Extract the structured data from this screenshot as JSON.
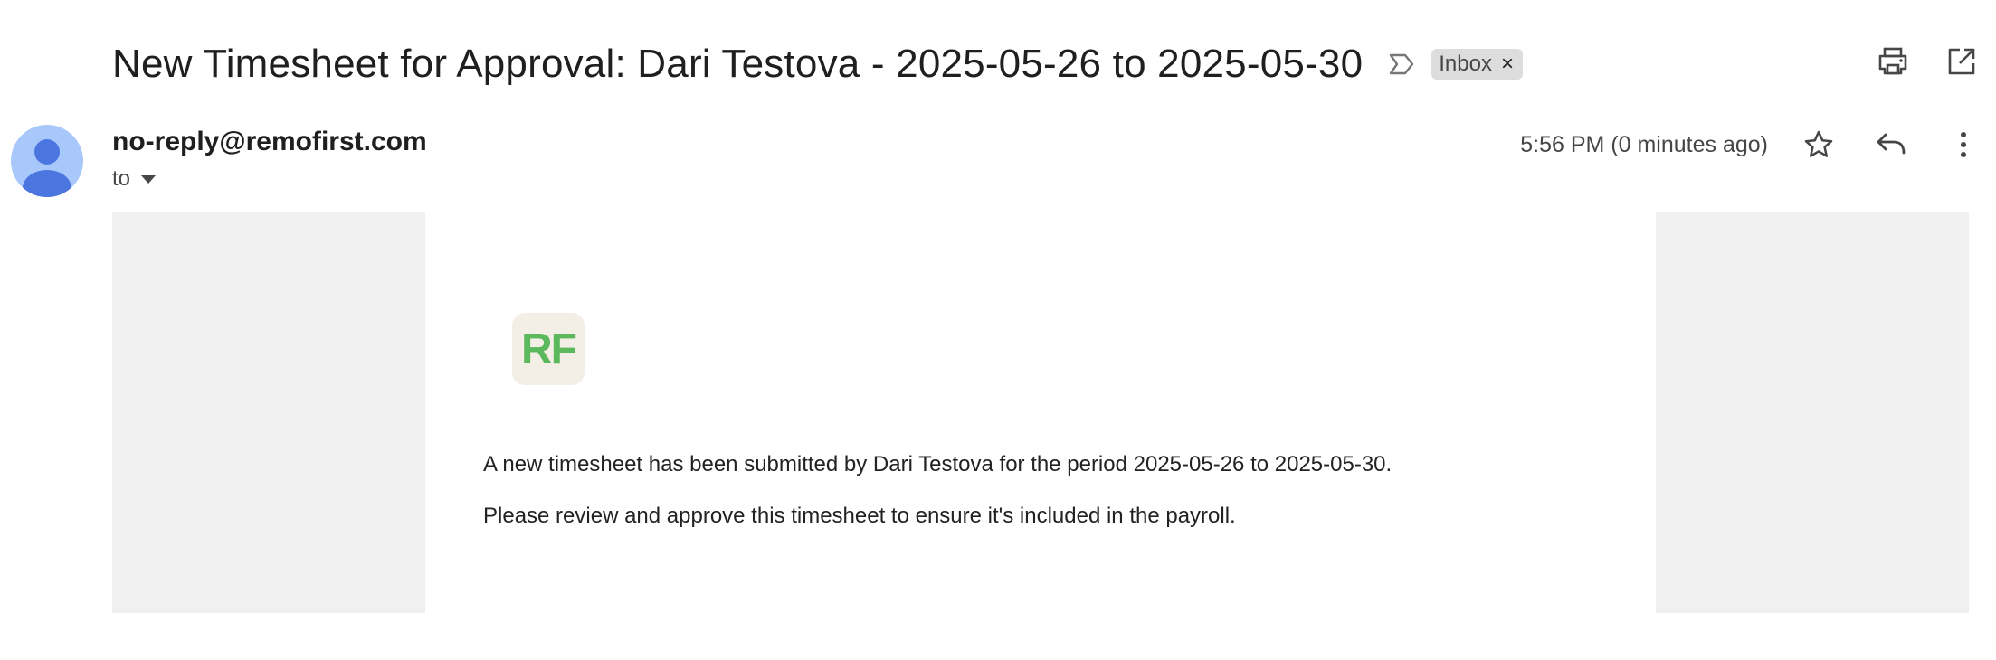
{
  "email": {
    "subject": "New Timesheet for Approval: Dari Testova - 2025-05-26 to 2025-05-30",
    "label_chip": "Inbox",
    "label_chip_remove": "×",
    "sender": "no-reply@remofirst.com",
    "to_label": "to",
    "timestamp": "5:56 PM (0 minutes ago)"
  },
  "body": {
    "logo_text": "RF",
    "paragraph1": "A new timesheet has been submitted by Dari Testova for the period 2025-05-26 to 2025-05-30.",
    "paragraph2": "Please review and approve this timesheet to ensure it's included in the payroll."
  },
  "icons": {
    "important": "label-important-icon",
    "print": "print-icon",
    "open_new_window": "open-in-new-icon",
    "star": "star-icon",
    "reply": "reply-icon",
    "more": "more-vert-icon"
  },
  "colors": {
    "avatar_bg": "#a8c7fa",
    "avatar_fg": "#4b76e0",
    "chip_bg": "#dddddd",
    "logo_bg": "#f3efe6",
    "logo_fg": "#5cb85c",
    "gutter": "#f0f0f0"
  }
}
